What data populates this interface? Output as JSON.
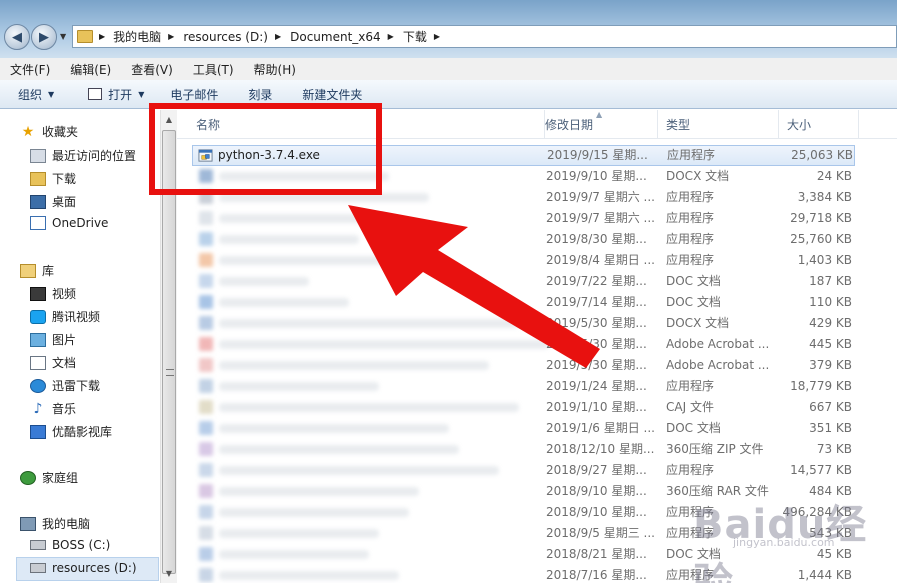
{
  "address": {
    "crumbs": [
      "我的电脑",
      "resources (D:)",
      "Document_x64",
      "下载"
    ]
  },
  "menu": [
    "文件(F)",
    "编辑(E)",
    "查看(V)",
    "工具(T)",
    "帮助(H)"
  ],
  "toolbar": {
    "organize": "组织",
    "open": "打开",
    "email": "电子邮件",
    "burn": "刻录",
    "new_folder": "新建文件夹"
  },
  "nav": {
    "favorites": "收藏夹",
    "recent": "最近访问的位置",
    "downloads": "下载",
    "desktop": "桌面",
    "onedrive": "OneDrive",
    "libraries": "库",
    "videos": "视频",
    "tencent_video": "腾讯视频",
    "pictures": "图片",
    "documents": "文档",
    "xunlei": "迅雷下载",
    "music": "音乐",
    "youku": "优酷影视库",
    "homegroup": "家庭组",
    "computer": "我的电脑",
    "drive_c": "BOSS (C:)",
    "drive_d": "resources (D:)"
  },
  "columns": {
    "name": "名称",
    "modified": "修改日期",
    "type": "类型",
    "size": "大小"
  },
  "selected_file": {
    "name": "python-3.7.4.exe",
    "date": "2019/9/15 星期...",
    "type": "应用程序",
    "size": "25,063 KB"
  },
  "rows": [
    {
      "date": "2019/9/10 星期...",
      "type": "DOCX 文档",
      "size": "24 KB"
    },
    {
      "date": "2019/9/7 星期六 ...",
      "type": "应用程序",
      "size": "3,384 KB"
    },
    {
      "date": "2019/9/7 星期六 ...",
      "type": "应用程序",
      "size": "29,718 KB"
    },
    {
      "date": "2019/8/30 星期...",
      "type": "应用程序",
      "size": "25,760 KB"
    },
    {
      "date": "2019/8/4 星期日 ...",
      "type": "应用程序",
      "size": "1,403 KB"
    },
    {
      "date": "2019/7/22 星期...",
      "type": "DOC 文档",
      "size": "187 KB"
    },
    {
      "date": "2019/7/14 星期...",
      "type": "DOC 文档",
      "size": "110 KB"
    },
    {
      "date": "2019/5/30 星期...",
      "type": "DOCX 文档",
      "size": "429 KB"
    },
    {
      "date": "2019/5/30 星期...",
      "type": "Adobe Acrobat ...",
      "size": "445 KB"
    },
    {
      "date": "2019/5/30 星期...",
      "type": "Adobe Acrobat ...",
      "size": "379 KB"
    },
    {
      "date": "2019/1/24 星期...",
      "type": "应用程序",
      "size": "18,779 KB"
    },
    {
      "date": "2019/1/10 星期...",
      "type": "CAJ 文件",
      "size": "667 KB"
    },
    {
      "date": "2019/1/6 星期日 ...",
      "type": "DOC 文档",
      "size": "351 KB"
    },
    {
      "date": "2018/12/10 星期...",
      "type": "360压缩 ZIP 文件",
      "size": "73 KB"
    },
    {
      "date": "2018/9/27 星期...",
      "type": "应用程序",
      "size": "14,577 KB"
    },
    {
      "date": "2018/9/10 星期...",
      "type": "360压缩 RAR 文件",
      "size": "484 KB"
    },
    {
      "date": "2018/9/10 星期...",
      "type": "应用程序",
      "size": "496,284 KB"
    },
    {
      "date": "2018/9/5 星期三 ...",
      "type": "应用程序",
      "size": "543 KB"
    },
    {
      "date": "2018/8/21 星期...",
      "type": "DOC 文档",
      "size": "45 KB"
    },
    {
      "date": "2018/7/16 星期...",
      "type": "应用程序",
      "size": "1,444 KB"
    }
  ],
  "watermark": {
    "big": "Baidu经验",
    "small": "jingyan.baidu.com"
  },
  "colors": {
    "highlight": "#e8110f",
    "selection": "#dce9f8"
  }
}
